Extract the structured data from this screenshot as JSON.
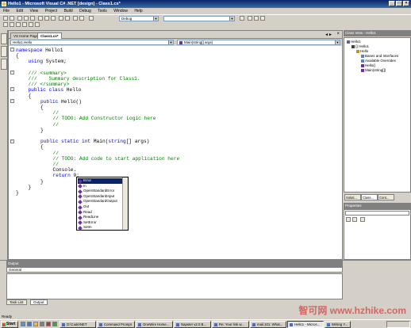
{
  "window": {
    "title": "Hello1 - Microsoft Visual C# .NET [design] - Class1.cs*"
  },
  "menu": [
    "File",
    "Edit",
    "View",
    "Project",
    "Build",
    "Debug",
    "Tools",
    "Window",
    "Help"
  ],
  "toolbar": {
    "config_value": "Debug",
    "search_value": ""
  },
  "doc_tabs": [
    "VS Home Page",
    "Class1.cs*"
  ],
  "nav": {
    "class_combo": "Hello1.Hello",
    "member_combo": "Main(string[] args)"
  },
  "code_lines": [
    {
      "indent": 0,
      "parts": [
        {
          "t": "namespace",
          "c": "kw"
        },
        {
          "t": " Hello1",
          "c": ""
        }
      ]
    },
    {
      "indent": 0,
      "parts": [
        {
          "t": "{",
          "c": ""
        }
      ]
    },
    {
      "indent": 1,
      "parts": [
        {
          "t": "using",
          "c": "kw"
        },
        {
          "t": " System;",
          "c": ""
        }
      ]
    },
    {
      "indent": 0,
      "parts": []
    },
    {
      "indent": 1,
      "parts": [
        {
          "t": "/// <summary>",
          "c": "cm"
        }
      ]
    },
    {
      "indent": 1,
      "parts": [
        {
          "t": "///    Summary description for Class1.",
          "c": "cm"
        }
      ]
    },
    {
      "indent": 1,
      "parts": [
        {
          "t": "/// </summary>",
          "c": "cm"
        }
      ]
    },
    {
      "indent": 1,
      "parts": [
        {
          "t": "public class",
          "c": "kw"
        },
        {
          "t": " Hello",
          "c": ""
        }
      ]
    },
    {
      "indent": 1,
      "parts": [
        {
          "t": "{",
          "c": ""
        }
      ]
    },
    {
      "indent": 2,
      "parts": [
        {
          "t": "public",
          "c": "kw"
        },
        {
          "t": " Hello()",
          "c": ""
        }
      ]
    },
    {
      "indent": 2,
      "parts": [
        {
          "t": "{",
          "c": ""
        }
      ]
    },
    {
      "indent": 3,
      "parts": [
        {
          "t": "//",
          "c": "cm"
        }
      ]
    },
    {
      "indent": 3,
      "parts": [
        {
          "t": "// TODO: Add Constructor Logic here",
          "c": "cm"
        }
      ]
    },
    {
      "indent": 3,
      "parts": [
        {
          "t": "//",
          "c": "cm"
        }
      ]
    },
    {
      "indent": 2,
      "parts": [
        {
          "t": "}",
          "c": ""
        }
      ]
    },
    {
      "indent": 0,
      "parts": []
    },
    {
      "indent": 2,
      "parts": [
        {
          "t": "public static int",
          "c": "kw"
        },
        {
          "t": " Main(",
          "c": ""
        },
        {
          "t": "string",
          "c": "kw"
        },
        {
          "t": "[] args)",
          "c": ""
        }
      ]
    },
    {
      "indent": 2,
      "parts": [
        {
          "t": "{",
          "c": ""
        }
      ]
    },
    {
      "indent": 3,
      "parts": [
        {
          "t": "//",
          "c": "cm"
        }
      ]
    },
    {
      "indent": 3,
      "parts": [
        {
          "t": "// TODO: Add code to start application here",
          "c": "cm"
        }
      ]
    },
    {
      "indent": 3,
      "parts": [
        {
          "t": "//",
          "c": "cm"
        }
      ]
    },
    {
      "indent": 3,
      "parts": [
        {
          "t": "Console.",
          "c": ""
        }
      ]
    },
    {
      "indent": 3,
      "parts": [
        {
          "t": "return",
          "c": "kw"
        },
        {
          "t": " 0;",
          "c": ""
        }
      ]
    },
    {
      "indent": 2,
      "parts": [
        {
          "t": "}",
          "c": ""
        }
      ]
    },
    {
      "indent": 1,
      "parts": [
        {
          "t": "}",
          "c": ""
        }
      ]
    },
    {
      "indent": 0,
      "parts": [
        {
          "t": "}",
          "c": ""
        }
      ]
    }
  ],
  "intellisense": {
    "items": [
      "Error",
      "In",
      "OpenStandardError",
      "OpenStandardInput",
      "OpenStandardOutput",
      "Out",
      "Read",
      "ReadLine",
      "SetError",
      "SetIn"
    ],
    "selected_index": 0
  },
  "class_view": {
    "title": "Class View - Hello1",
    "tree": [
      {
        "level": 0,
        "label": "Hello1",
        "color": "#6060a0"
      },
      {
        "level": 1,
        "label": "{} Hello1",
        "color": "#404040"
      },
      {
        "level": 2,
        "label": "Hello",
        "color": "#c09030"
      },
      {
        "level": 3,
        "label": "Bases and Interfaces",
        "color": "#6080c0"
      },
      {
        "level": 3,
        "label": "Available Overrides",
        "color": "#6080c0"
      },
      {
        "level": 3,
        "label": "Hello()",
        "color": "#7030a0"
      },
      {
        "level": 3,
        "label": "Main(string[])",
        "color": "#7030a0"
      }
    ]
  },
  "pane_tabs": [
    "Soluti...",
    "Class...",
    "Cont..."
  ],
  "properties": {
    "title": "Properties"
  },
  "output": {
    "title": "Output",
    "combo": "General"
  },
  "output_tabs": [
    "Task List",
    "Output"
  ],
  "status": "Ready",
  "taskbar": {
    "start": "Start",
    "tasks": [
      "D:\\Code\\NET",
      "Command Prompt",
      "OneWire Home...",
      "Napster v2.0 B...",
      "Re: Your link w...",
      "mail.101: What...",
      "Hello1 - Micros...",
      "Writing Y..."
    ],
    "active_index": 6,
    "clock": ""
  },
  "watermark": "智可网 www.hzhike.com"
}
